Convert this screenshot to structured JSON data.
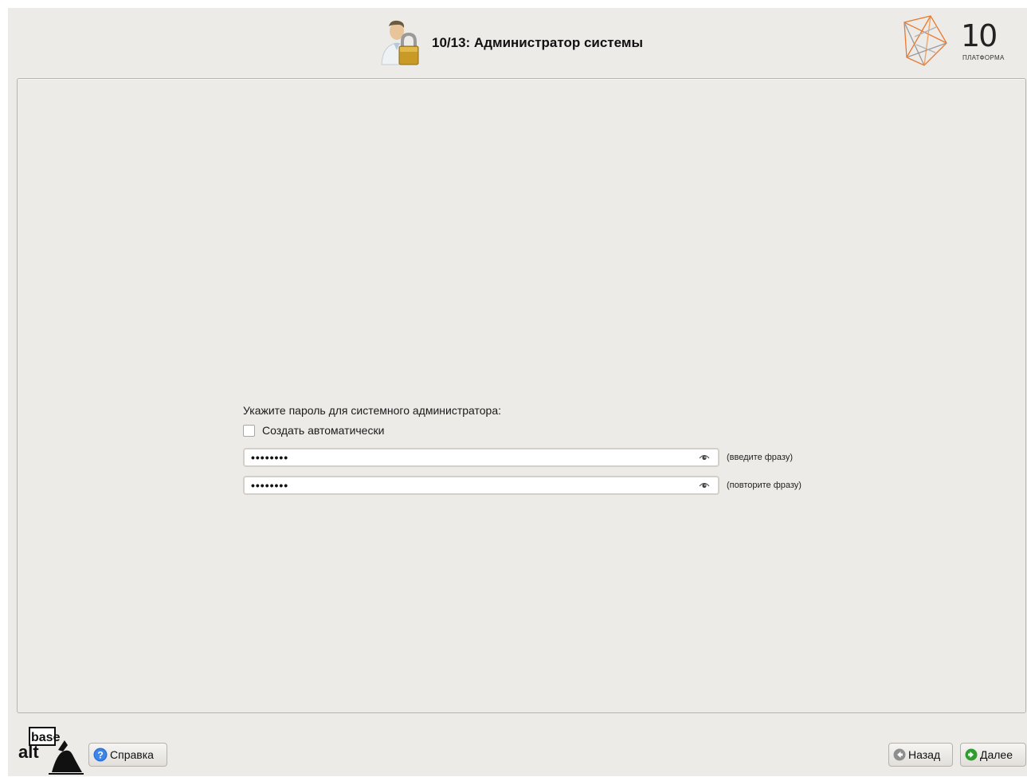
{
  "header": {
    "title": "10/13: Администратор системы",
    "logo_number": "10",
    "logo_text": "ПЛАТФОРМА"
  },
  "form": {
    "prompt": "Укажите пароль для системного администратора:",
    "auto_generate_label": "Создать автоматически",
    "auto_generate_checked": false,
    "password_value": "••••••••",
    "password_hint": "(введите фразу)",
    "confirm_value": "••••••••",
    "confirm_hint": "(повторите фразу)"
  },
  "footer": {
    "brand_line1": "base",
    "brand_line2": "alt",
    "help_label": "Справка",
    "back_label": "Назад",
    "next_label": "Далее"
  },
  "colors": {
    "background": "#edebe8",
    "logo_accent": "#e8792e"
  }
}
